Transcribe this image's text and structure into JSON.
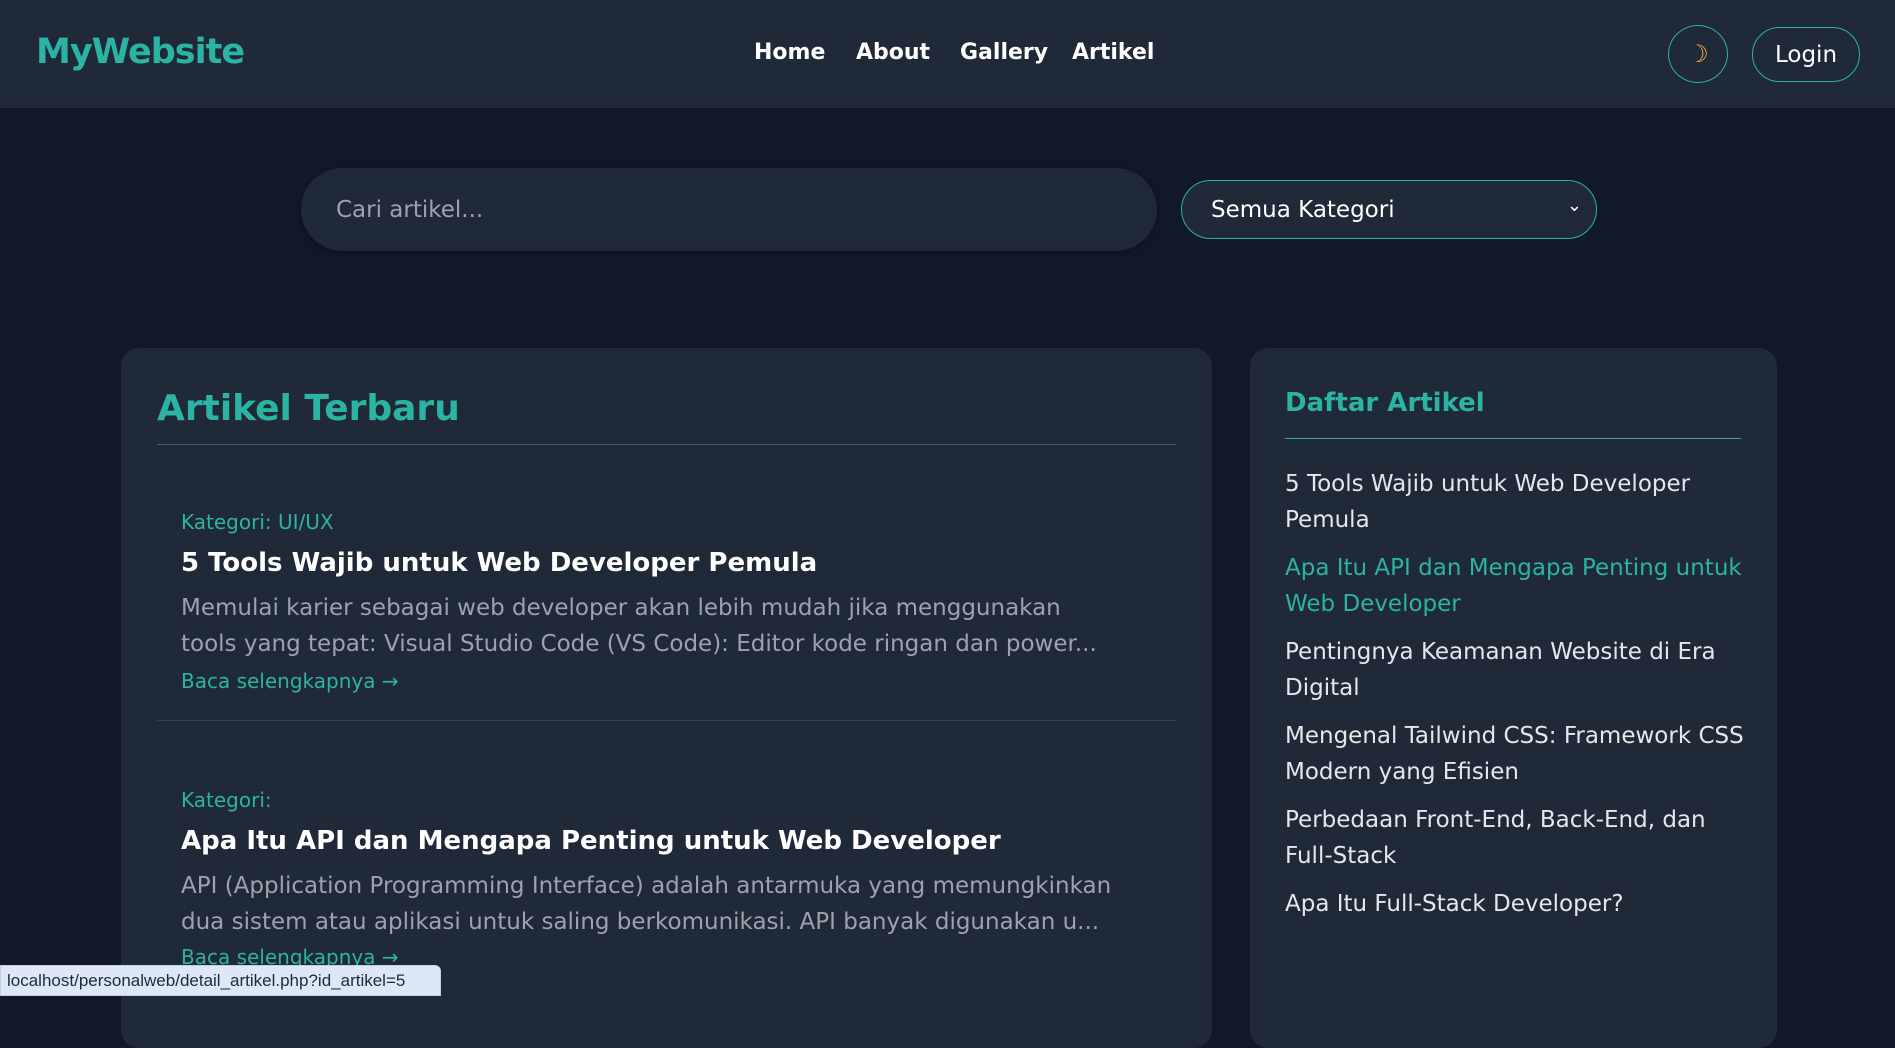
{
  "nav": {
    "logo": "MyWebsite",
    "links": [
      "Home",
      "About",
      "Gallery",
      "Artikel"
    ],
    "theme_icon": "☽",
    "login": "Login"
  },
  "search": {
    "placeholder": "Cari artikel...",
    "category": "Semua Kategori"
  },
  "main": {
    "heading": "Artikel Terbaru",
    "articles": [
      {
        "category": "Kategori: UI/UX",
        "title": "5 Tools Wajib untuk Web Developer Pemula",
        "excerpt": "Memulai karier sebagai web developer akan lebih mudah jika menggunakan tools yang tepat: Visual Studio Code (VS Code): Editor kode ringan dan power...",
        "link": "Baca selengkapnya →"
      },
      {
        "category": "Kategori:",
        "title": "Apa Itu API dan Mengapa Penting untuk Web Developer",
        "excerpt": "API (Application Programming Interface) adalah antarmuka yang memungkinkan dua sistem atau aplikasi untuk saling berkomunikasi. API banyak digunakan u...",
        "link": "Baca selengkapnya →"
      }
    ]
  },
  "sidebar": {
    "heading": "Daftar Artikel",
    "items": [
      "5 Tools Wajib untuk Web Developer Pemula",
      "Apa Itu API dan Mengapa Penting untuk Web Developer",
      "Pentingnya Keamanan Website di Era Digital",
      "Mengenal Tailwind CSS: Framework CSS Modern yang Efisien",
      "Perbedaan Front-End, Back-End, dan Full-Stack",
      "Apa Itu Full-Stack Developer?"
    ]
  },
  "status_url": "localhost/personalweb/detail_artikel.php?id_artikel=5"
}
